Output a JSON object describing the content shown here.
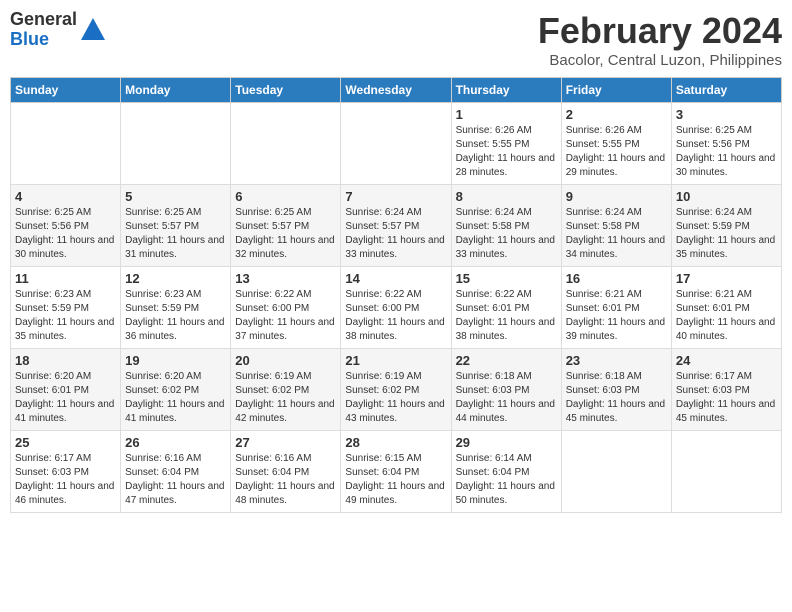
{
  "logo": {
    "general": "General",
    "blue": "Blue"
  },
  "title": "February 2024",
  "location": "Bacolor, Central Luzon, Philippines",
  "days_header": [
    "Sunday",
    "Monday",
    "Tuesday",
    "Wednesday",
    "Thursday",
    "Friday",
    "Saturday"
  ],
  "weeks": [
    [
      {
        "day": "",
        "info": ""
      },
      {
        "day": "",
        "info": ""
      },
      {
        "day": "",
        "info": ""
      },
      {
        "day": "",
        "info": ""
      },
      {
        "day": "1",
        "info": "Sunrise: 6:26 AM\nSunset: 5:55 PM\nDaylight: 11 hours and 28 minutes."
      },
      {
        "day": "2",
        "info": "Sunrise: 6:26 AM\nSunset: 5:55 PM\nDaylight: 11 hours and 29 minutes."
      },
      {
        "day": "3",
        "info": "Sunrise: 6:25 AM\nSunset: 5:56 PM\nDaylight: 11 hours and 30 minutes."
      }
    ],
    [
      {
        "day": "4",
        "info": "Sunrise: 6:25 AM\nSunset: 5:56 PM\nDaylight: 11 hours and 30 minutes."
      },
      {
        "day": "5",
        "info": "Sunrise: 6:25 AM\nSunset: 5:57 PM\nDaylight: 11 hours and 31 minutes."
      },
      {
        "day": "6",
        "info": "Sunrise: 6:25 AM\nSunset: 5:57 PM\nDaylight: 11 hours and 32 minutes."
      },
      {
        "day": "7",
        "info": "Sunrise: 6:24 AM\nSunset: 5:57 PM\nDaylight: 11 hours and 33 minutes."
      },
      {
        "day": "8",
        "info": "Sunrise: 6:24 AM\nSunset: 5:58 PM\nDaylight: 11 hours and 33 minutes."
      },
      {
        "day": "9",
        "info": "Sunrise: 6:24 AM\nSunset: 5:58 PM\nDaylight: 11 hours and 34 minutes."
      },
      {
        "day": "10",
        "info": "Sunrise: 6:24 AM\nSunset: 5:59 PM\nDaylight: 11 hours and 35 minutes."
      }
    ],
    [
      {
        "day": "11",
        "info": "Sunrise: 6:23 AM\nSunset: 5:59 PM\nDaylight: 11 hours and 35 minutes."
      },
      {
        "day": "12",
        "info": "Sunrise: 6:23 AM\nSunset: 5:59 PM\nDaylight: 11 hours and 36 minutes."
      },
      {
        "day": "13",
        "info": "Sunrise: 6:22 AM\nSunset: 6:00 PM\nDaylight: 11 hours and 37 minutes."
      },
      {
        "day": "14",
        "info": "Sunrise: 6:22 AM\nSunset: 6:00 PM\nDaylight: 11 hours and 38 minutes."
      },
      {
        "day": "15",
        "info": "Sunrise: 6:22 AM\nSunset: 6:01 PM\nDaylight: 11 hours and 38 minutes."
      },
      {
        "day": "16",
        "info": "Sunrise: 6:21 AM\nSunset: 6:01 PM\nDaylight: 11 hours and 39 minutes."
      },
      {
        "day": "17",
        "info": "Sunrise: 6:21 AM\nSunset: 6:01 PM\nDaylight: 11 hours and 40 minutes."
      }
    ],
    [
      {
        "day": "18",
        "info": "Sunrise: 6:20 AM\nSunset: 6:01 PM\nDaylight: 11 hours and 41 minutes."
      },
      {
        "day": "19",
        "info": "Sunrise: 6:20 AM\nSunset: 6:02 PM\nDaylight: 11 hours and 41 minutes."
      },
      {
        "day": "20",
        "info": "Sunrise: 6:19 AM\nSunset: 6:02 PM\nDaylight: 11 hours and 42 minutes."
      },
      {
        "day": "21",
        "info": "Sunrise: 6:19 AM\nSunset: 6:02 PM\nDaylight: 11 hours and 43 minutes."
      },
      {
        "day": "22",
        "info": "Sunrise: 6:18 AM\nSunset: 6:03 PM\nDaylight: 11 hours and 44 minutes."
      },
      {
        "day": "23",
        "info": "Sunrise: 6:18 AM\nSunset: 6:03 PM\nDaylight: 11 hours and 45 minutes."
      },
      {
        "day": "24",
        "info": "Sunrise: 6:17 AM\nSunset: 6:03 PM\nDaylight: 11 hours and 45 minutes."
      }
    ],
    [
      {
        "day": "25",
        "info": "Sunrise: 6:17 AM\nSunset: 6:03 PM\nDaylight: 11 hours and 46 minutes."
      },
      {
        "day": "26",
        "info": "Sunrise: 6:16 AM\nSunset: 6:04 PM\nDaylight: 11 hours and 47 minutes."
      },
      {
        "day": "27",
        "info": "Sunrise: 6:16 AM\nSunset: 6:04 PM\nDaylight: 11 hours and 48 minutes."
      },
      {
        "day": "28",
        "info": "Sunrise: 6:15 AM\nSunset: 6:04 PM\nDaylight: 11 hours and 49 minutes."
      },
      {
        "day": "29",
        "info": "Sunrise: 6:14 AM\nSunset: 6:04 PM\nDaylight: 11 hours and 50 minutes."
      },
      {
        "day": "",
        "info": ""
      },
      {
        "day": "",
        "info": ""
      }
    ]
  ]
}
